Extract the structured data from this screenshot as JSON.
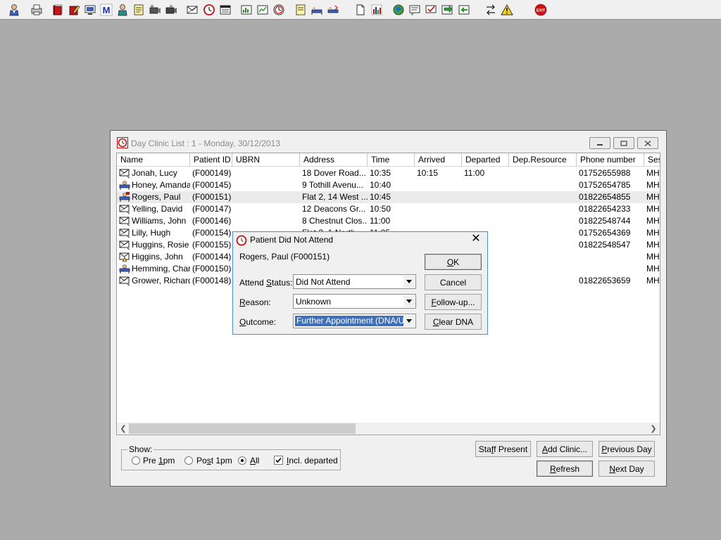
{
  "toolbar": {
    "icons": [
      "patient-search-icon",
      "printer-icon",
      "red-book-icon",
      "edit-book-icon",
      "monitor-icon",
      "letter-m-icon",
      "clinician-icon",
      "notepad-icon",
      "camera-icon",
      "camera-2-icon",
      "envelope-icon",
      "clock-icon",
      "window-icon",
      "chart-window-icon",
      "chart-window-2-icon",
      "clock-2-icon",
      "note-icon",
      "bed-icon",
      "bed-2-icon",
      "document-icon",
      "bar-chart-icon",
      "globe-icon",
      "message-icon",
      "check-message-icon",
      "green-box-icon",
      "swap-arrows-icon",
      "warning-icon",
      "exit-icon"
    ],
    "exit_label": "EXIT"
  },
  "main_window": {
    "title": "Day Clinic List : 1 - Monday, 30/12/2013",
    "columns": [
      "Name",
      "Patient ID",
      "UBRN",
      "Address",
      "Time",
      "Arrived",
      "Departed",
      "Dep.Resource",
      "Phone number",
      "Ses"
    ],
    "rows": [
      {
        "icon": "envelope-icon",
        "name": "Jonah, Lucy",
        "id": "(F000149)",
        "ubrn": "",
        "address": "18 Dover Road...",
        "time": "10:35",
        "arrived": "10:15",
        "departed": "11:00",
        "dep": "",
        "phone": "01752655988",
        "ses": "MH"
      },
      {
        "icon": "bed-icon",
        "name": "Honey, Amanda",
        "id": "(F000145)",
        "ubrn": "",
        "address": "9 Tothill Avenu...",
        "time": "10:40",
        "arrived": "",
        "departed": "",
        "dep": "",
        "phone": "01752654785",
        "ses": "MH"
      },
      {
        "icon": "bed-red-icon",
        "name": "Rogers, Paul",
        "id": "(F000151)",
        "ubrn": "",
        "address": "Flat 2, 14 West ...",
        "time": "10:45",
        "arrived": "",
        "departed": "",
        "dep": "",
        "phone": "01822654855",
        "ses": "MH"
      },
      {
        "icon": "envelope-icon",
        "name": "Yelling, David",
        "id": "(F000147)",
        "ubrn": "",
        "address": "12 Deacons Gr...",
        "time": "10:50",
        "arrived": "",
        "departed": "",
        "dep": "",
        "phone": "01822654233",
        "ses": "MH"
      },
      {
        "icon": "envelope-icon",
        "name": "Williams, John",
        "id": "(F000146)",
        "ubrn": "",
        "address": "8 Chestnut Clos...",
        "time": "11:00",
        "arrived": "",
        "departed": "",
        "dep": "",
        "phone": "01822548744",
        "ses": "MH"
      },
      {
        "icon": "envelope-icon",
        "name": "Lilly, Hugh",
        "id": "(F000154)",
        "ubrn": "",
        "address": "Flat 3, 1 North...",
        "time": "11:05",
        "arrived": "",
        "departed": "",
        "dep": "",
        "phone": "01752654369",
        "ses": "MH"
      },
      {
        "icon": "envelope-icon",
        "name": "Huggins, Rosie",
        "id": "(F000155)",
        "ubrn": "",
        "address": "",
        "time": "",
        "arrived": "",
        "departed": "",
        "dep": "",
        "phone": "01822548547",
        "ses": "MH"
      },
      {
        "icon": "envelope-warn-icon",
        "name": "Higgins, John",
        "id": "(F000144)",
        "ubrn": "",
        "address": "",
        "time": "",
        "arrived": "",
        "departed": "",
        "dep": "",
        "phone": "",
        "ses": "MH"
      },
      {
        "icon": "bed-icon",
        "name": "Hemming, Char...",
        "id": "(F000150)",
        "ubrn": "",
        "address": "",
        "time": "",
        "arrived": "",
        "departed": "",
        "dep": "",
        "phone": "",
        "ses": "MH"
      },
      {
        "icon": "envelope-icon",
        "name": "Grower, Richard",
        "id": "(F000148)",
        "ubrn": "",
        "address": "",
        "time": "",
        "arrived": "",
        "departed": "",
        "dep": "",
        "phone": "01822653659",
        "ses": "MH"
      }
    ],
    "selected_row": 2,
    "show": {
      "legend": "Show:",
      "pre": {
        "pre": "Pre ",
        "key": "1",
        "post": "pm"
      },
      "post": {
        "pre": "Po",
        "key": "s",
        "post": "t 1pm"
      },
      "all": {
        "pre": "",
        "key": "A",
        "post": "ll"
      },
      "incl": {
        "pre": "",
        "key": "I",
        "post": "ncl. departed"
      },
      "selected": "all",
      "incl_checked": true
    },
    "buttons": {
      "staff_present": {
        "pre": "Sta",
        "key": "f",
        "post": "f Present"
      },
      "add_clinic": {
        "pre": "",
        "key": "A",
        "post": "dd Clinic..."
      },
      "previous_day": {
        "pre": "",
        "key": "P",
        "post": "revious Day"
      },
      "refresh": {
        "pre": "",
        "key": "R",
        "post": "efresh"
      },
      "next_day": {
        "pre": "",
        "key": "N",
        "post": "ext Day"
      }
    }
  },
  "dialog": {
    "title": "Patient Did Not Attend",
    "patient": "Rogers, Paul (F000151)",
    "attend_status": {
      "pre": "Attend ",
      "key": "S",
      "post": "tatus:",
      "value": "Did Not Attend"
    },
    "reason": {
      "pre": "",
      "key": "R",
      "post": "eason:",
      "value": "Unknown"
    },
    "outcome": {
      "pre": "",
      "key": "O",
      "post": "utcome:",
      "value": "Further Appointment (DNA/UTA)"
    },
    "ok": {
      "pre": "",
      "key": "O",
      "post": "K"
    },
    "cancel": "Cancel",
    "follow_up": {
      "pre": "",
      "key": "F",
      "post": "ollow-up..."
    },
    "clear_dna": {
      "pre": "",
      "key": "C",
      "post": "lear DNA"
    }
  }
}
